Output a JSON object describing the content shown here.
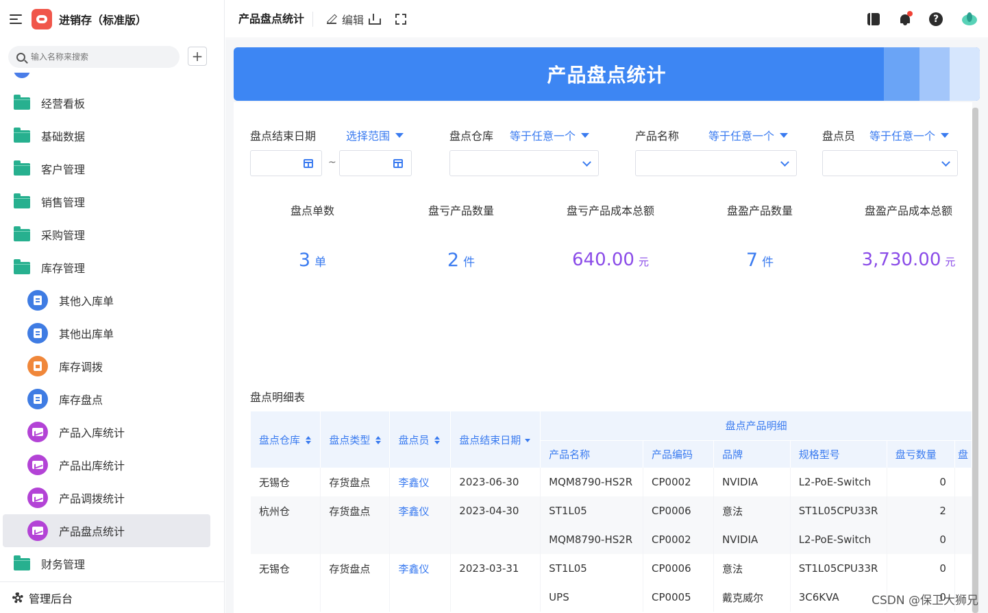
{
  "app": {
    "title": "进销存（标准版）"
  },
  "sidebar": {
    "search_placeholder": "输入名称来搜索",
    "add_symbol": "+",
    "items": [
      {
        "label": "经营看板",
        "type": "group",
        "icon": "folder-icon"
      },
      {
        "label": "基础数据",
        "type": "group",
        "icon": "folder-icon"
      },
      {
        "label": "客户管理",
        "type": "group",
        "icon": "folder-icon"
      },
      {
        "label": "销售管理",
        "type": "group",
        "icon": "folder-icon"
      },
      {
        "label": "采购管理",
        "type": "group",
        "icon": "folder-icon"
      },
      {
        "label": "库存管理",
        "type": "group",
        "icon": "folder-icon",
        "expanded": true
      },
      {
        "label": "其他入库单",
        "type": "child",
        "icon": "form-icon"
      },
      {
        "label": "其他出库单",
        "type": "child",
        "icon": "form-icon"
      },
      {
        "label": "库存调拨",
        "type": "child",
        "icon": "clipboard-icon"
      },
      {
        "label": "库存盘点",
        "type": "child",
        "icon": "form-icon"
      },
      {
        "label": "产品入库统计",
        "type": "child",
        "icon": "report-icon"
      },
      {
        "label": "产品出库统计",
        "type": "child",
        "icon": "report-icon"
      },
      {
        "label": "产品调拨统计",
        "type": "child",
        "icon": "report-icon"
      },
      {
        "label": "产品盘点统计",
        "type": "child",
        "icon": "report-icon",
        "active": true
      },
      {
        "label": "财务管理",
        "type": "group",
        "icon": "folder-icon"
      }
    ],
    "footer_label": "管理后台"
  },
  "topbar": {
    "page_title": "产品盘点统计",
    "edit_label": "编辑"
  },
  "banner": {
    "title": "产品盘点统计"
  },
  "filters": {
    "end_date": {
      "label": "盘点结束日期",
      "op": "选择范围",
      "separator": "~"
    },
    "warehouse": {
      "label": "盘点仓库",
      "op": "等于任意一个"
    },
    "product": {
      "label": "产品名称",
      "op": "等于任意一个"
    },
    "counter": {
      "label": "盘点员",
      "op": "等于任意一个"
    }
  },
  "stats": [
    {
      "label": "盘点单数",
      "value": "3",
      "unit": "单"
    },
    {
      "label": "盘亏产品数量",
      "value": "2",
      "unit": "件"
    },
    {
      "label": "盘亏产品成本总额",
      "value": "640.00",
      "unit": "元"
    },
    {
      "label": "盘盈产品数量",
      "value": "7",
      "unit": "件"
    },
    {
      "label": "盘盈产品成本总额",
      "value": "3,730.00",
      "unit": "元"
    }
  ],
  "table": {
    "title": "盘点明细表",
    "group_header": "盘点产品明细",
    "headers": {
      "warehouse": "盘点仓库",
      "type": "盘点类型",
      "counter": "盘点员",
      "end_date": "盘点结束日期",
      "product_name": "产品名称",
      "product_code": "产品编码",
      "brand": "品牌",
      "spec": "规格型号",
      "loss_qty": "盘亏数量",
      "cut_off": "盘"
    },
    "rows": [
      {
        "warehouse": "无锡仓",
        "type": "存货盘点",
        "counter": "李鑫仪",
        "end_date": "2023-06-30",
        "product_name": "MQM8790-HS2R",
        "product_code": "CP0002",
        "brand": "NVIDIA",
        "spec": "L2-PoE-Switch",
        "loss_qty": "0"
      },
      {
        "warehouse": "杭州仓",
        "type": "存货盘点",
        "counter": "李鑫仪",
        "end_date": "2023-04-30",
        "product_name": "ST1L05",
        "product_code": "CP0006",
        "brand": "意法",
        "spec": "ST1L05CPU33R",
        "loss_qty": "2"
      },
      {
        "warehouse": "",
        "type": "",
        "counter": "",
        "end_date": "",
        "product_name": "MQM8790-HS2R",
        "product_code": "CP0002",
        "brand": "NVIDIA",
        "spec": "L2-PoE-Switch",
        "loss_qty": "0"
      },
      {
        "warehouse": "无锡仓",
        "type": "存货盘点",
        "counter": "李鑫仪",
        "end_date": "2023-03-31",
        "product_name": "ST1L05",
        "product_code": "CP0006",
        "brand": "意法",
        "spec": "ST1L05CPU33R",
        "loss_qty": "0"
      },
      {
        "warehouse": "",
        "type": "",
        "counter": "",
        "end_date": "",
        "product_name": "UPS",
        "product_code": "CP0005",
        "brand": "戴克威尔",
        "spec": "3C6KVA",
        "loss_qty": "0"
      }
    ]
  },
  "watermark": "CSDN @保卫大狮兄",
  "colors": {
    "accent": "#3a7bf0",
    "folder": "#27b08f",
    "banner": "#3d86f3",
    "purple_value": "#8a4be8"
  }
}
